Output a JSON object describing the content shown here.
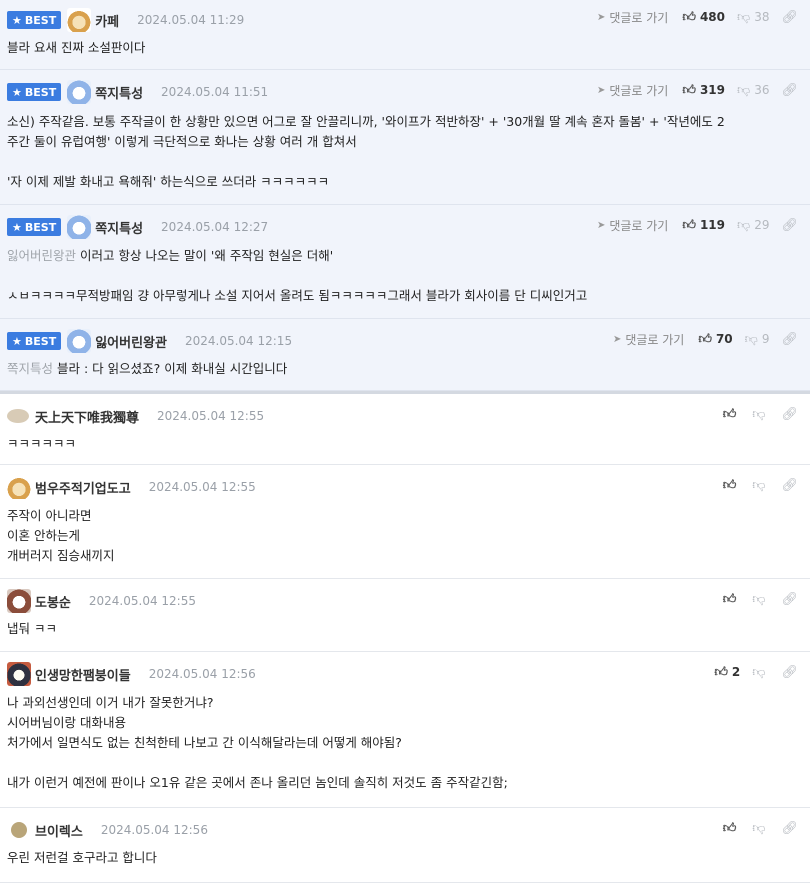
{
  "comments": [
    {
      "best": true,
      "badge": "BEST",
      "nick": "카페",
      "date": "2024.05.04 11:29",
      "reply": "댓글로 가기",
      "up": "480",
      "down": "38",
      "lines": [
        "블라 요새 진짜 소설판이다"
      ]
    },
    {
      "best": true,
      "badge": "BEST",
      "nick": "쪽지특성",
      "date": "2024.05.04 11:51",
      "reply": "댓글로 가기",
      "up": "319",
      "down": "36",
      "lines": [
        "소신) 주작같음. 보통 주작글이 한 상황만 있으면 어그로 잘 안끌리니까, '와이프가 적반하장' + '30개월 딸 계속 혼자 돌봄' + '작년에도 2",
        "주간 둘이 유럽여행' 이렇게 극단적으로 화나는 상황 여러 개 합쳐서",
        "",
        "'자 이제 제발 화내고 욕해줘' 하는식으로 쓰더라 ㅋㅋㅋㅋㅋㅋ"
      ]
    },
    {
      "best": true,
      "badge": "BEST",
      "nick": "쪽지특성",
      "date": "2024.05.04 12:27",
      "reply": "댓글로 가기",
      "up": "119",
      "down": "29",
      "mention": "잃어버린왕관",
      "lines": [
        "이러고 항상 나오는 말이 '왜 주작임 현실은 더해'",
        "",
        "ㅅㅂㅋㅋㅋㅋ무적방패임 걍 아무렇게나 소설 지어서 올려도 됨ㅋㅋㅋㅋㅋ그래서 블라가 회사이름 단 디씨인거고"
      ]
    },
    {
      "best": true,
      "badge": "BEST",
      "nick": "잃어버린왕관",
      "date": "2024.05.04 12:15",
      "reply": "댓글로 가기",
      "up": "70",
      "down": "9",
      "mention": "쪽지특성",
      "lines": [
        "블라 : 다 읽으셨죠? 이제 화내실 시간입니다"
      ]
    },
    {
      "best": false,
      "nick": "天上天下唯我獨尊",
      "date": "2024.05.04 12:55",
      "up": "",
      "lines": [
        "ㅋㅋㅋㅋㅋㅋ"
      ]
    },
    {
      "best": false,
      "nick": "범우주적기업도고",
      "date": "2024.05.04 12:55",
      "up": "",
      "lines": [
        "주작이 아니라면",
        "이혼 안하는게",
        "개버러지 짐승새끼지"
      ]
    },
    {
      "best": false,
      "nick": "도봉순",
      "date": "2024.05.04 12:55",
      "up": "",
      "lines": [
        "냅둬 ㅋㅋ"
      ]
    },
    {
      "best": false,
      "nick": "인생망한팸붕이들",
      "date": "2024.05.04 12:56",
      "up": "2",
      "lines": [
        "나 과외선생인데 이거 내가 잘못한거냐?",
        "시어버님이랑 대화내용",
        "처가에서 일면식도 없는 친척한테 나보고 간 이식해달라는데 어떻게 해야됨?",
        "",
        "내가 이런거 예전에 판이나 오1유 같은 곳에서 존나 올리던 놈인데 솔직히 저것도 좀 주작같긴함;"
      ]
    },
    {
      "best": false,
      "nick": "브이렉스",
      "date": "2024.05.04 12:56",
      "up": "",
      "lines": [
        "우린 저런걸 호구라고 합니다"
      ]
    }
  ]
}
